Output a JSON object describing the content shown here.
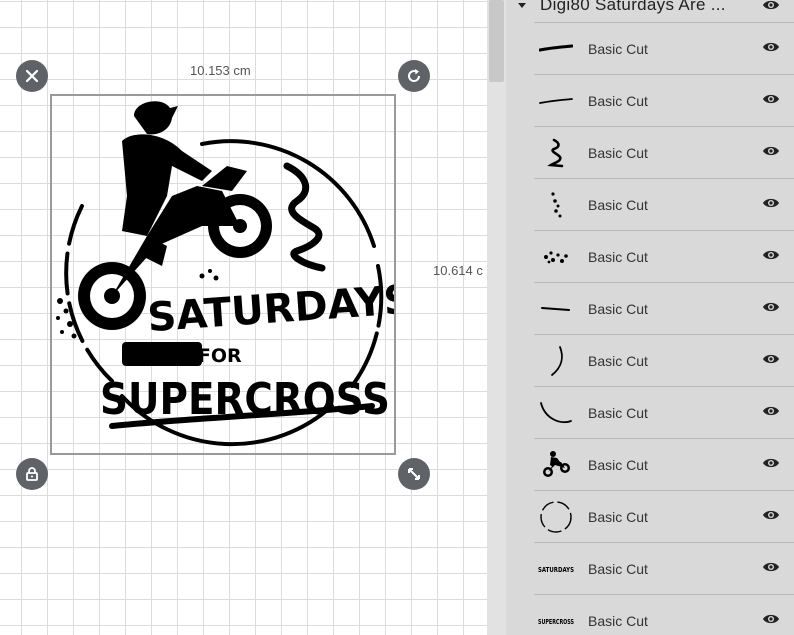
{
  "canvas": {
    "width_label": "10.153 cm",
    "height_label": "10.614 c",
    "artwork_text": {
      "line1": "SATURDAYS",
      "line2": "ARE FOR",
      "line3": "SUPERCROSS"
    }
  },
  "handles": {
    "close_icon": "close-icon",
    "rotate_icon": "rotate-icon",
    "lock_icon": "lock-icon",
    "resize_icon": "resize-icon"
  },
  "layers_panel": {
    "group_title": "Digi80 Saturdays Are ...",
    "layers": [
      {
        "label": "Basic Cut",
        "thumb": "stroke-long"
      },
      {
        "label": "Basic Cut",
        "thumb": "stroke-thin"
      },
      {
        "label": "Basic Cut",
        "thumb": "squiggle"
      },
      {
        "label": "Basic Cut",
        "thumb": "dots-vertical"
      },
      {
        "label": "Basic Cut",
        "thumb": "dots-cluster"
      },
      {
        "label": "Basic Cut",
        "thumb": "line-short"
      },
      {
        "label": "Basic Cut",
        "thumb": "arc-right"
      },
      {
        "label": "Basic Cut",
        "thumb": "arc-bottom"
      },
      {
        "label": "Basic Cut",
        "thumb": "motocross-rider"
      },
      {
        "label": "Basic Cut",
        "thumb": "dashed-circle"
      },
      {
        "label": "Basic Cut",
        "thumb": "text-saturdays"
      },
      {
        "label": "Basic Cut",
        "thumb": "text-supercross"
      }
    ],
    "thumb_text_1": "SATURDAYS",
    "thumb_text_2": "SUPERCROSS"
  },
  "colors": {
    "panel_bg": "#d9d9d9",
    "handle_bg": "#5f6368",
    "grid_line": "#dcdcdc"
  }
}
